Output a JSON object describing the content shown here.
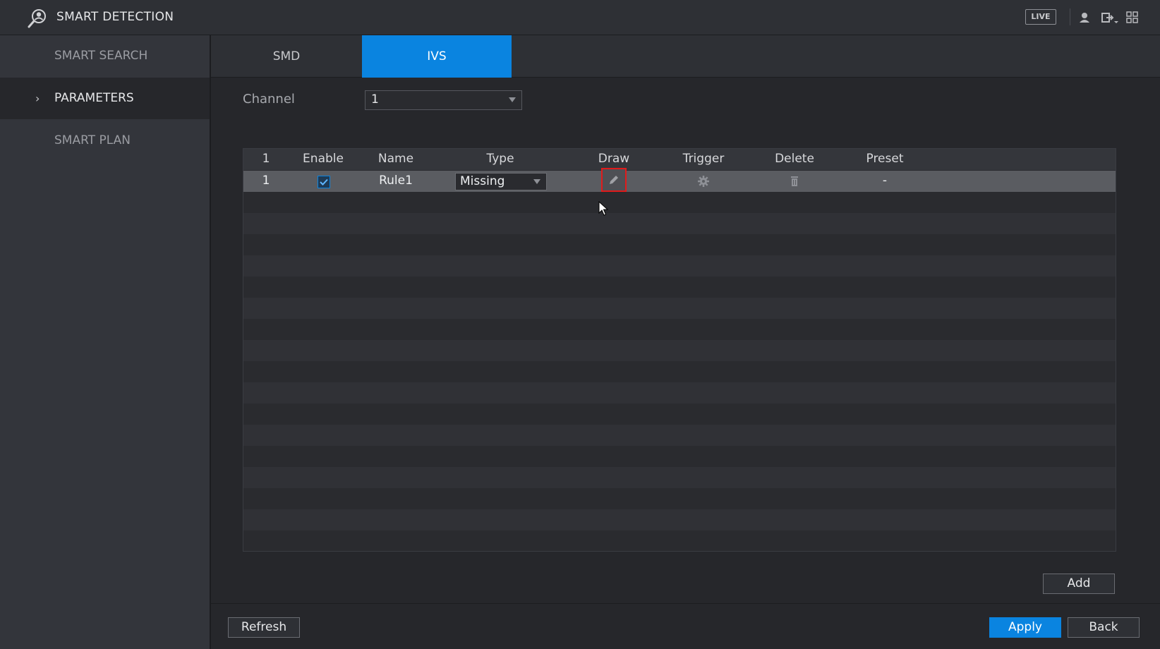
{
  "header": {
    "title": "SMART DETECTION",
    "live_badge": "LIVE",
    "icons": [
      "smart-detection-icon",
      "user-icon",
      "logout-icon",
      "grid-icon"
    ]
  },
  "sidebar": {
    "items": [
      {
        "label": "SMART SEARCH",
        "selected": false
      },
      {
        "label": "PARAMETERS",
        "selected": true
      },
      {
        "label": "SMART PLAN",
        "selected": false
      }
    ]
  },
  "tabs": [
    {
      "label": "SMD",
      "active": false
    },
    {
      "label": "IVS",
      "active": true
    }
  ],
  "channel": {
    "label": "Channel",
    "value": "1"
  },
  "table": {
    "headers": [
      "1",
      "Enable",
      "Name",
      "Type",
      "Draw",
      "Trigger",
      "Delete",
      "Preset"
    ],
    "rows": [
      {
        "index": "1",
        "enabled": true,
        "name": "Rule1",
        "type": "Missing",
        "preset": "-"
      }
    ],
    "icons": {
      "draw": "pencil-icon",
      "trigger": "gear-icon",
      "delete": "trash-icon"
    }
  },
  "buttons": {
    "add": "Add",
    "refresh": "Refresh",
    "apply": "Apply",
    "back": "Back"
  },
  "colors": {
    "accent": "#0a84e0",
    "highlight_border": "#e01b1b",
    "background": "#26272b",
    "sidebar": "#33353b"
  }
}
